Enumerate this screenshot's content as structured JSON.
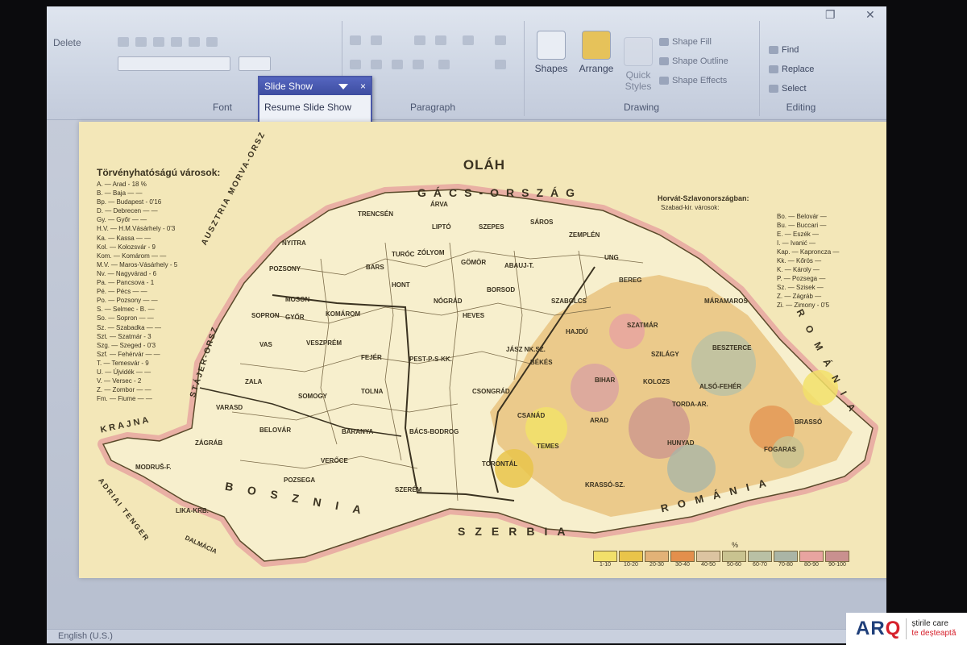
{
  "ribbon": {
    "delete_label": "Delete",
    "groups": {
      "font": "Font",
      "paragraph": "Paragraph",
      "drawing": "Drawing",
      "editing": "Editing"
    },
    "drawing_buttons": {
      "shapes": "Shapes",
      "arrange": "Arrange",
      "quick_styles": "Quick Styles",
      "shape_fill": "Shape Fill",
      "shape_outline": "Shape Outline",
      "shape_effects": "Shape Effects"
    },
    "editing_buttons": {
      "find": "Find",
      "replace": "Replace",
      "select": "Select"
    }
  },
  "slideshow_popup": {
    "title": "Slide Show",
    "close": "×",
    "resume": "Resume Slide Show"
  },
  "map": {
    "title": "OLÁH",
    "legend_title": "Törvényhatóságú városok:",
    "legend_items": [
      "A. — Arad - 18 %",
      "B. — Baja — —",
      "Bp. — Budapest - 0'16",
      "D. — Debrecen — —",
      "Gy. — Győr — —",
      "H.V. — H.M.Vásárhely - 0'3",
      "Ka. — Kassa — —",
      "Kol. — Kolozsvár - 9",
      "Kom. — Komárom — —",
      "M.V. — Maros-Vásárhely - 5",
      "Nv. — Nagyvárad - 6",
      "Pa. — Pancsova - 1",
      "Pé. — Pécs — —",
      "Po. — Pozsony — —",
      "S. — Selmec - B. —",
      "So. — Sopron — —",
      "Sz. — Szabadka — —",
      "Szt. — Szatmár - 3",
      "Szg. — Szeged - 0'3",
      "Szf. — Fehérvár — —",
      "T. — Temesvár - 9",
      "U. — Újvidék — —",
      "V. — Versec - 2",
      "Z. — Zombor — —",
      "Fm. — Fiume — —"
    ],
    "croatia_title": "Horvát-Szlavonországban:",
    "croatia_sub": "Szabad-kir. városok:",
    "croatia_items": [
      "Bo. — Belovár —",
      "Bu. — Buccari —",
      "E. — Eszék —",
      "I. — Ivanić —",
      "Kap. — Kaproncza —",
      "Kk. — Kőrös —",
      "K. — Károly —",
      "P. — Pozsega —",
      "Sz. — Szisek —",
      "Z. — Zágráb —",
      "Zi. — Zimony - 0'5"
    ],
    "counties": [
      "NYITRA",
      "POZSONY",
      "TRENCSÉN",
      "ÁRVA",
      "TURÓC",
      "LIPTÓ",
      "SZEPES",
      "SÁROS",
      "ZEMPLÉN",
      "UNG",
      "BEREG",
      "BARS",
      "ZÓLYOM",
      "GÖMÖR",
      "ABAUJ-T.",
      "HONT",
      "BORSOD",
      "NÓGRÁD",
      "HEVES",
      "SZABOLCS",
      "MÁRAMAROS",
      "MOSON",
      "GYŐR",
      "KOMÁROM",
      "SOPRON",
      "VAS",
      "VESZPRÉM",
      "FEJÉR",
      "PEST-P-S-KK.",
      "JÁSZ NK.SZ.",
      "HAJDÚ",
      "SZATMÁR",
      "SZILÁGY",
      "BIHAR",
      "KOLOZS",
      "BESZTERCE",
      "ZALA",
      "SOMOGY",
      "TOLNA",
      "BÉKÉS",
      "CSONGRÁD",
      "CSANÁD",
      "ARAD",
      "TORDA-AR.",
      "BRASSÓ",
      "VARASD",
      "BELOVÁR",
      "ZÁGRÁB",
      "BARANYA",
      "BÁCS-BODROG",
      "TEMES",
      "KRASSÓ-SZ.",
      "HUNYAD",
      "FOGARAS",
      "VERŐCE",
      "POZSEGA",
      "MODRUŠ-F.",
      "LIKA-KRB.",
      "SZERÉM",
      "TORONTÁL",
      "ALSÓ-FEHÉR"
    ],
    "neighbors": {
      "north_galicia": "GÁCS-ORSZÁG",
      "west_austria": "AUSZTRIA MORVA-ORSZ",
      "southwest_styria": "STÁJER-ORSZ",
      "krajna": "KRAJNA",
      "adriatic": "ADRIAI TENGER",
      "dalmatia": "DALMÁCIA",
      "south_bosnia": "BOSZNIA",
      "south_serbia": "SZERBIA",
      "east_romania": "ROMÁNIA",
      "southeast_romania": "ROMÁNIA"
    },
    "scale_symbol": "%",
    "scale_labels": [
      "1-10",
      "10-20",
      "20-30",
      "30-40",
      "40-50",
      "50-60",
      "60-70",
      "70-80",
      "80-90",
      "90-100"
    ],
    "scale_colors": [
      "#f2e06a",
      "#e9c44a",
      "#e2b277",
      "#e38f4c",
      "#dcc4a1",
      "#c9c390",
      "#b9c0a5",
      "#aab5a6",
      "#e8a4a0",
      "#c9908f"
    ]
  },
  "statusbar": {
    "language": "English (U.S.)"
  },
  "watermark": {
    "logo_main": "AR",
    "logo_accent": "Q",
    "tagline_1": "știrile care",
    "tagline_2": "te deșteaptă"
  }
}
